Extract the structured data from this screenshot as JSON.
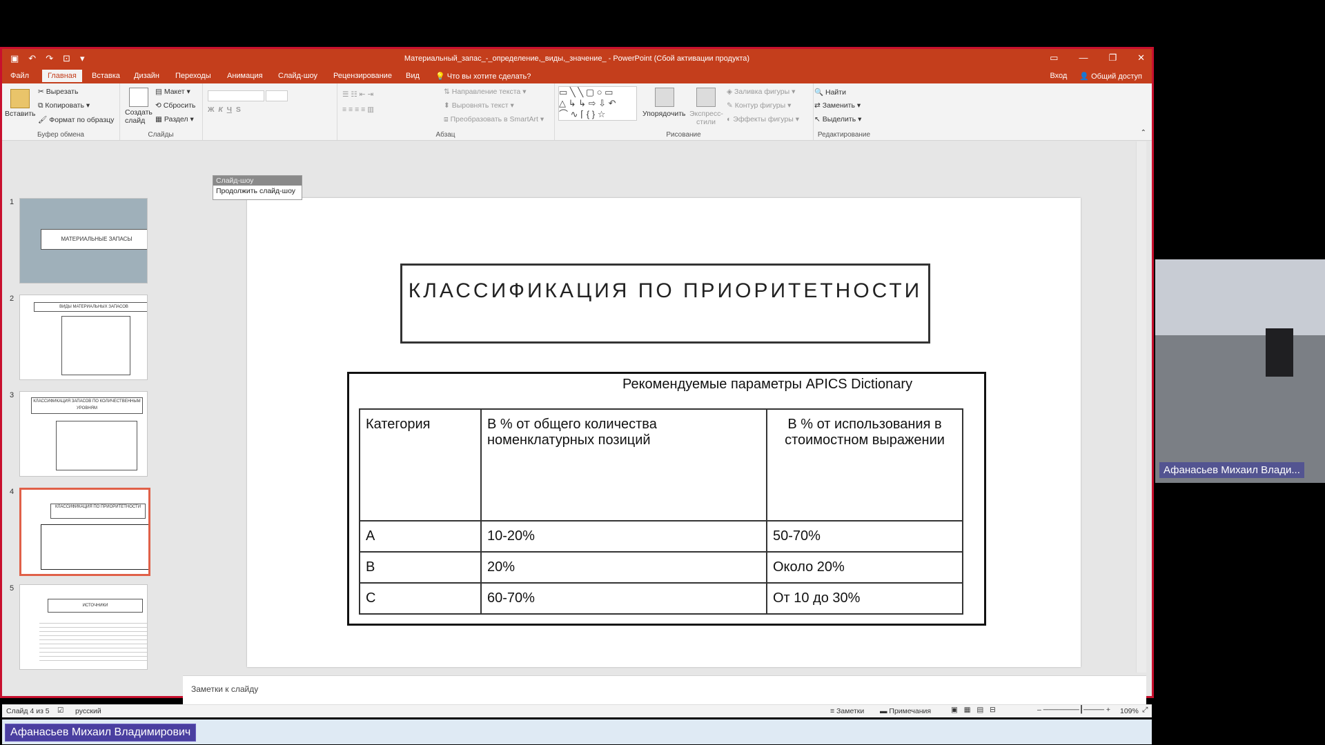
{
  "window": {
    "title": "Материальный_запас_-_определение,_виды,_значение_ - PowerPoint (Сбой активации продукта)",
    "qat": [
      "save-icon",
      "undo-icon",
      "redo-icon",
      "start-icon",
      "customize-icon"
    ]
  },
  "tabs": [
    "Файл",
    "Главная",
    "Вставка",
    "Дизайн",
    "Переходы",
    "Анимация",
    "Слайд-шоу",
    "Рецензирование",
    "Вид"
  ],
  "active_tab": "Главная",
  "tell_me": "Что вы хотите сделать?",
  "sign_in": "Вход",
  "share": "Общий доступ",
  "ribbon": {
    "clipboard": {
      "paste": "Вставить",
      "cut": "Вырезать",
      "copy": "Копировать",
      "format_painter": "Формат по образцу",
      "label": "Буфер обмена"
    },
    "slides": {
      "new_slide": "Создать слайд",
      "layout": "Макет",
      "reset": "Сбросить",
      "section": "Раздел",
      "label": "Слайды"
    },
    "paragraph": {
      "text_direction": "Направление текста",
      "align_text": "Выровнять текст",
      "smartart": "Преобразовать в SmartArt",
      "label": "Абзац"
    },
    "drawing": {
      "arrange": "Упорядочить",
      "quick_styles": "Экспресс-стили",
      "fill": "Заливка фигуры",
      "outline": "Контур фигуры",
      "effects": "Эффекты фигуры",
      "label": "Рисование"
    },
    "editing": {
      "find": "Найти",
      "replace": "Заменить",
      "select": "Выделить",
      "label": "Редактирование"
    }
  },
  "popup": {
    "header": "Слайд-шоу",
    "item": "Продолжить слайд-шоу"
  },
  "thumbnails": [
    {
      "num": "1",
      "title": "МАТЕРИАЛЬНЫЕ ЗАПАСЫ"
    },
    {
      "num": "2",
      "title": "ВИДЫ МАТЕРИАЛЬНЫХ ЗАПАСОВ"
    },
    {
      "num": "3",
      "title": "КЛАССИФИКАЦИЯ ЗАПАСОВ ПО КОЛИЧЕСТВЕННЫМ УРОВНЯМ"
    },
    {
      "num": "4",
      "title": "КЛАССИФИКАЦИЯ ПО ПРИОРИТЕТНОСТИ"
    },
    {
      "num": "5",
      "title": "ИСТОЧНИКИ"
    }
  ],
  "slide": {
    "title": "КЛАССИФИКАЦИЯ ПО ПРИОРИТЕТНОСТИ",
    "caption": "Рекомендуемые параметры APICS Dictionary",
    "headers": [
      "Категория",
      "В % от общего количества номенклатурных позиций",
      "В % от использования в стоимостном выражении"
    ],
    "rows": [
      [
        "A",
        "10-20%",
        "50-70%"
      ],
      [
        "B",
        "20%",
        "Около 20%"
      ],
      [
        "C",
        "60-70%",
        "От 10 до 30%"
      ]
    ]
  },
  "notes_placeholder": "Заметки к слайду",
  "status": {
    "slide_info": "Слайд 4 из 5",
    "language": "русский",
    "notes": "Заметки",
    "comments": "Примечания",
    "zoom": "109%"
  },
  "participant_video_name": "Афанасьев Михаил Влади...",
  "presenter_name": "Афанасьев Михаил Владимирович"
}
